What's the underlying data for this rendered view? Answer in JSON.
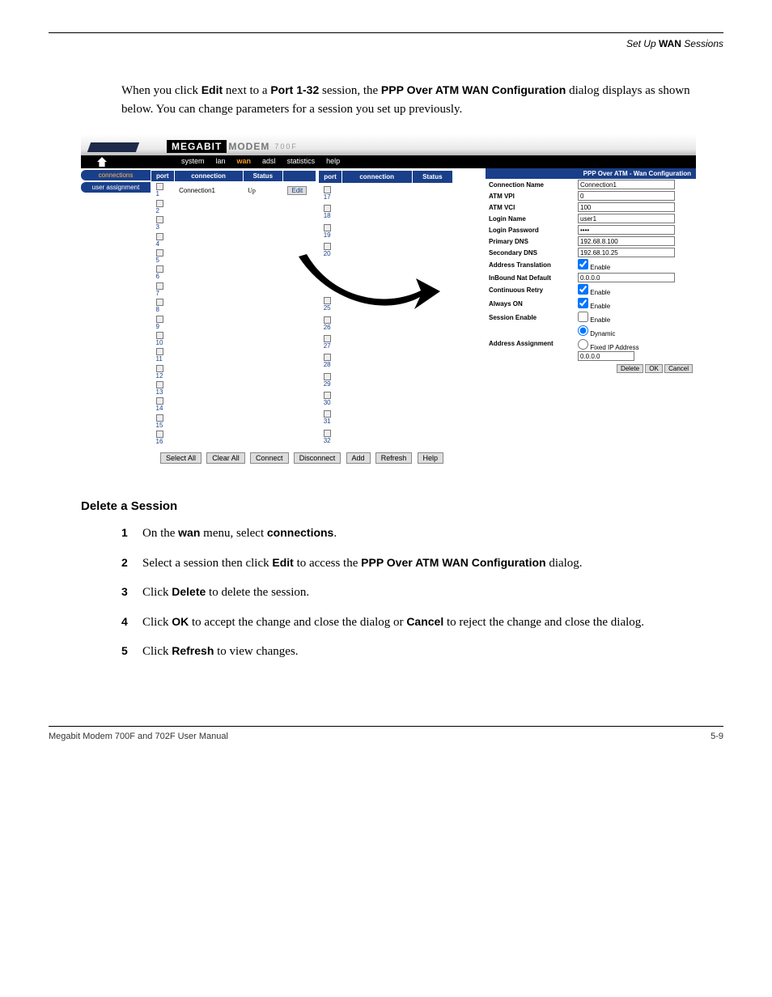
{
  "breadcrumb": {
    "prefix": "Set Up ",
    "bold": "WAN",
    "suffix": " Sessions"
  },
  "intro": {
    "t1": "When you click ",
    "b1": "Edit",
    "t2": " next to a ",
    "b2": "Port 1-32",
    "t3": " session, the ",
    "b3": "PPP Over ATM WAN Configuration",
    "t4": " dialog displays as shown below. You can change parameters for a session you set up previously."
  },
  "screenshot": {
    "brand": {
      "b1": "MEGABIT",
      "b2": "MODEM",
      "b3": "700F"
    },
    "menu": {
      "system": "system",
      "lan": "lan",
      "wan": "wan",
      "adsl": "adsl",
      "statistics": "statistics",
      "help": "help"
    },
    "sidenav": {
      "connections": "connections",
      "user_assignment": "user assignment"
    },
    "headers": {
      "port": "port",
      "connection": "connection",
      "status": "Status"
    },
    "row1": {
      "port": "1",
      "conn": "Connection1",
      "status": "Up",
      "edit": "Edit"
    },
    "ports_left": [
      "2",
      "3",
      "4",
      "5",
      "6",
      "7",
      "8",
      "9",
      "10",
      "11",
      "12",
      "13",
      "14",
      "15",
      "16"
    ],
    "ports_right_top": [
      "17",
      "18",
      "19",
      "20"
    ],
    "ports_right_bottom": [
      "25",
      "26",
      "27",
      "28",
      "29",
      "30",
      "31",
      "32"
    ],
    "buttons": {
      "selectall": "Select All",
      "clearall": "Clear All",
      "connect": "Connect",
      "disconnect": "Disconnect",
      "add": "Add",
      "refresh": "Refresh",
      "help": "Help"
    },
    "config": {
      "title": "PPP Over ATM - Wan Configuration",
      "fields": {
        "conn_name_l": "Connection Name",
        "conn_name_v": "Connection1",
        "vpi_l": "ATM VPI",
        "vpi_v": "0",
        "vci_l": "ATM VCI",
        "vci_v": "100",
        "login_l": "Login Name",
        "login_v": "user1",
        "pwd_l": "Login Password",
        "pwd_v": "••••",
        "pdns_l": "Primary DNS",
        "pdns_v": "192.68.8.100",
        "sdns_l": "Secondary DNS",
        "sdns_v": "192.68.10.25",
        "at_l": "Address Translation",
        "at_v": "Enable",
        "nat_l": "InBound Nat Default",
        "nat_v": "0.0.0.0",
        "cr_l": "Continuous Retry",
        "cr_v": "Enable",
        "ao_l": "Always ON",
        "ao_v": "Enable",
        "se_l": "Session Enable",
        "se_v": "Enable",
        "aa_l": "Address Assignment",
        "aa_dyn": "Dynamic",
        "aa_fix": "Fixed IP Address",
        "aa_fix_v": "0.0.0.0"
      },
      "buttons": {
        "delete": "Delete",
        "ok": "OK",
        "cancel": "Cancel"
      }
    }
  },
  "proc": {
    "heading": "Delete a Session",
    "s1": {
      "t1": "On the ",
      "b1": "wan",
      "t2": " menu, select ",
      "b2": "connections",
      "t3": "."
    },
    "s2": {
      "t1": "Select a session then click ",
      "b1": "Edit",
      "t2": " to access the ",
      "b2": "PPP Over ATM WAN Configuration",
      "t3": " dialog."
    },
    "s3": {
      "t1": "Click ",
      "b1": "Delete",
      "t2": " to delete the session."
    },
    "s4": {
      "t1": "Click ",
      "b1": "OK",
      "t2": " to accept the change and close the dialog or ",
      "b2": "Cancel",
      "t3": " to reject the change and close the dialog."
    },
    "s5": {
      "t1": "Click ",
      "b1": "Refresh",
      "t2": " to view changes."
    }
  },
  "footer": {
    "left": "Megabit Modem 700F and 702F User Manual",
    "right": "5-9"
  }
}
